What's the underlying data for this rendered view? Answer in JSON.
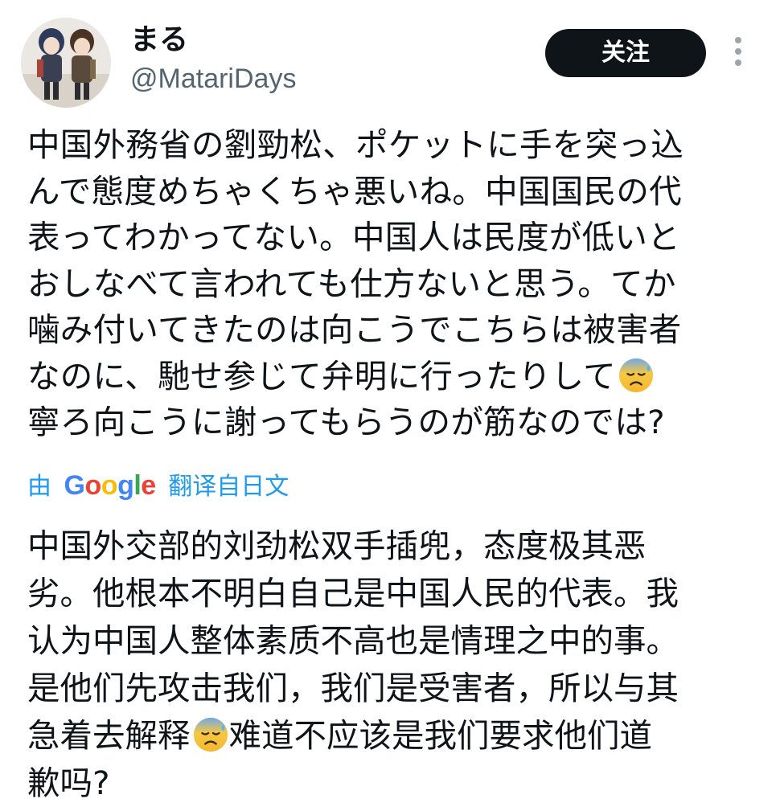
{
  "user": {
    "display_name": "まる",
    "handle": "@MatariDays"
  },
  "actions": {
    "follow_label": "关注",
    "more_icon": "more-vertical-icon"
  },
  "tweet": {
    "original_lines": [
      "中国外務省の劉勁松、ポケットに手を突っ込",
      "んで態度めちゃくちゃ悪いね。中国国民の代",
      "表ってわかってない。中国人は民度が低いと",
      "おしなべて言われても仕方ないと思う。てか",
      "噛み付いてきたのは向こうでこちらは被害者",
      "なのに、馳せ参じて弁明に行ったりして",
      "寧ろ向こうに謝ってもらうのが筋なのでは?"
    ],
    "emoji": "anxious-face-with-sweat-icon"
  },
  "translation": {
    "prefix": "由",
    "provider_letters": [
      "G",
      "o",
      "o",
      "g",
      "l",
      "e"
    ],
    "suffix": "翻译自日文",
    "lines": [
      "中国外交部的刘劲松双手插兜，态度极其恶",
      "劣。他根本不明白自己是中国人民的代表。我",
      "认为中国人整体素质不高也是情理之中的事。",
      "是他们先攻击我们，我们是受害者，所以与其",
      "急着去解释",
      "难道不应该是我们要求他们道",
      "歉吗?"
    ]
  }
}
